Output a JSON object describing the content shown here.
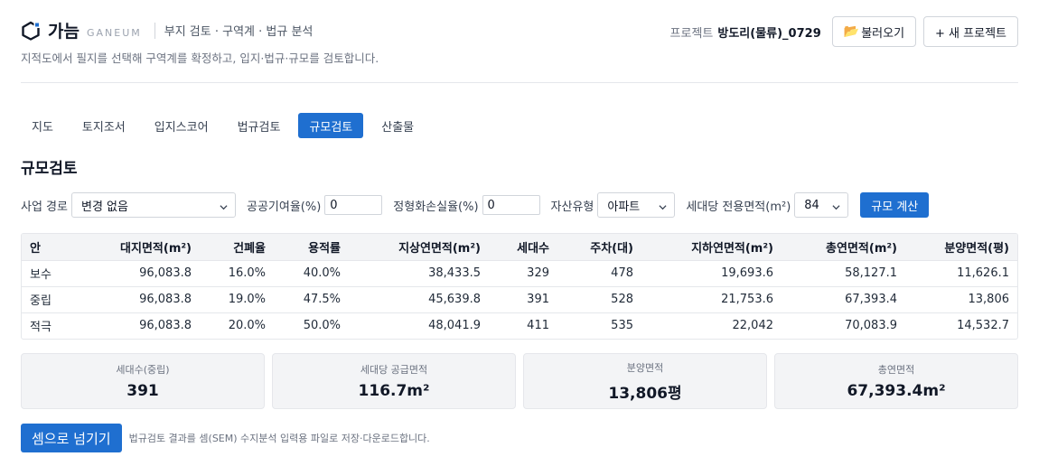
{
  "header": {
    "brand_name": "가늠",
    "brand_sub": "GANEUM",
    "tagline": "부지 검토 · 구역계 · 법규 분석",
    "subtitle": "지적도에서 필지를 선택해 구역계를 확정하고, 입지·법규·규모를 검토합니다.",
    "project_label": "프로젝트",
    "project_name": "방도리(물류)_0729",
    "load_button": "불러오기",
    "new_project_button": "+ 새 프로젝트"
  },
  "tabs": [
    {
      "label": "지도",
      "active": false
    },
    {
      "label": "토지조서",
      "active": false
    },
    {
      "label": "입지스코어",
      "active": false
    },
    {
      "label": "법규검토",
      "active": false
    },
    {
      "label": "규모검토",
      "active": true
    },
    {
      "label": "산출물",
      "active": false
    }
  ],
  "section_title": "규모검토",
  "form": {
    "route_label": "사업 경로",
    "route_value": "변경 없음",
    "public_label": "공공기여율(%)",
    "public_value": "0",
    "loss_label": "정형화손실율(%)",
    "loss_value": "0",
    "asset_label": "자산유형",
    "asset_value": "아파트",
    "unit_area_label": "세대당 전용면적(m²)",
    "unit_area_value": "84",
    "calc_button": "규모 계산"
  },
  "table": {
    "headers": [
      "안",
      "대지면적(m²)",
      "건폐율",
      "용적률",
      "지상연면적(m²)",
      "세대수",
      "주차(대)",
      "지하연면적(m²)",
      "총연면적(m²)",
      "분양면적(평)"
    ],
    "rows": [
      [
        "보수",
        "96,083.8",
        "16.0%",
        "40.0%",
        "38,433.5",
        "329",
        "478",
        "19,693.6",
        "58,127.1",
        "11,626.1"
      ],
      [
        "중립",
        "96,083.8",
        "19.0%",
        "47.5%",
        "45,639.8",
        "391",
        "528",
        "21,753.6",
        "67,393.4",
        "13,806"
      ],
      [
        "적극",
        "96,083.8",
        "20.0%",
        "50.0%",
        "48,041.9",
        "411",
        "535",
        "22,042",
        "70,083.9",
        "14,532.7"
      ]
    ]
  },
  "stats": [
    {
      "label": "세대수(중립)",
      "value": "391"
    },
    {
      "label": "세대당 공급면적",
      "value": "116.7m²"
    },
    {
      "label": "분양면적",
      "value": "13,806평"
    },
    {
      "label": "총연면적",
      "value": "67,393.4m²"
    }
  ],
  "footer": {
    "send_button": "셈으로 넘기기",
    "note": "법규검토 결과를 셈(SEM) 수지분석 입력용 파일로 저장·다운로드합니다."
  },
  "colors": {
    "accent": "#1f6fd0",
    "header_bg": "#f3f4f6"
  }
}
